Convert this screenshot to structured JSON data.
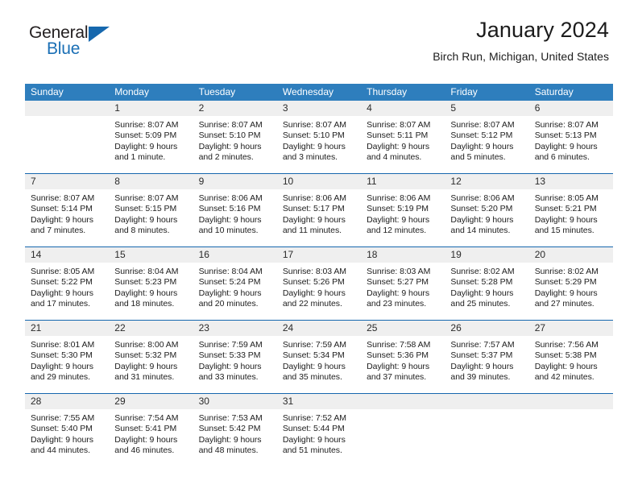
{
  "brand": {
    "name_top": "General",
    "name_bottom": "Blue",
    "triangle_color": "#1668ae",
    "blue_color": "#1a6fb5",
    "dark_color": "#231f20"
  },
  "header": {
    "title": "January 2024",
    "subtitle": "Birch Run, Michigan, United States"
  },
  "theme": {
    "header_blue": "#2e7ebd",
    "rule_blue": "#1667ae",
    "daynum_band": "#efefef",
    "text": "#202020"
  },
  "weekdays": [
    "Sunday",
    "Monday",
    "Tuesday",
    "Wednesday",
    "Thursday",
    "Friday",
    "Saturday"
  ],
  "weeks": [
    [
      {
        "day": "",
        "lines": [
          "",
          "",
          "",
          ""
        ]
      },
      {
        "day": "1",
        "lines": [
          "Sunrise: 8:07 AM",
          "Sunset: 5:09 PM",
          "Daylight: 9 hours",
          "and 1 minute."
        ]
      },
      {
        "day": "2",
        "lines": [
          "Sunrise: 8:07 AM",
          "Sunset: 5:10 PM",
          "Daylight: 9 hours",
          "and 2 minutes."
        ]
      },
      {
        "day": "3",
        "lines": [
          "Sunrise: 8:07 AM",
          "Sunset: 5:10 PM",
          "Daylight: 9 hours",
          "and 3 minutes."
        ]
      },
      {
        "day": "4",
        "lines": [
          "Sunrise: 8:07 AM",
          "Sunset: 5:11 PM",
          "Daylight: 9 hours",
          "and 4 minutes."
        ]
      },
      {
        "day": "5",
        "lines": [
          "Sunrise: 8:07 AM",
          "Sunset: 5:12 PM",
          "Daylight: 9 hours",
          "and 5 minutes."
        ]
      },
      {
        "day": "6",
        "lines": [
          "Sunrise: 8:07 AM",
          "Sunset: 5:13 PM",
          "Daylight: 9 hours",
          "and 6 minutes."
        ]
      }
    ],
    [
      {
        "day": "7",
        "lines": [
          "Sunrise: 8:07 AM",
          "Sunset: 5:14 PM",
          "Daylight: 9 hours",
          "and 7 minutes."
        ]
      },
      {
        "day": "8",
        "lines": [
          "Sunrise: 8:07 AM",
          "Sunset: 5:15 PM",
          "Daylight: 9 hours",
          "and 8 minutes."
        ]
      },
      {
        "day": "9",
        "lines": [
          "Sunrise: 8:06 AM",
          "Sunset: 5:16 PM",
          "Daylight: 9 hours",
          "and 10 minutes."
        ]
      },
      {
        "day": "10",
        "lines": [
          "Sunrise: 8:06 AM",
          "Sunset: 5:17 PM",
          "Daylight: 9 hours",
          "and 11 minutes."
        ]
      },
      {
        "day": "11",
        "lines": [
          "Sunrise: 8:06 AM",
          "Sunset: 5:19 PM",
          "Daylight: 9 hours",
          "and 12 minutes."
        ]
      },
      {
        "day": "12",
        "lines": [
          "Sunrise: 8:06 AM",
          "Sunset: 5:20 PM",
          "Daylight: 9 hours",
          "and 14 minutes."
        ]
      },
      {
        "day": "13",
        "lines": [
          "Sunrise: 8:05 AM",
          "Sunset: 5:21 PM",
          "Daylight: 9 hours",
          "and 15 minutes."
        ]
      }
    ],
    [
      {
        "day": "14",
        "lines": [
          "Sunrise: 8:05 AM",
          "Sunset: 5:22 PM",
          "Daylight: 9 hours",
          "and 17 minutes."
        ]
      },
      {
        "day": "15",
        "lines": [
          "Sunrise: 8:04 AM",
          "Sunset: 5:23 PM",
          "Daylight: 9 hours",
          "and 18 minutes."
        ]
      },
      {
        "day": "16",
        "lines": [
          "Sunrise: 8:04 AM",
          "Sunset: 5:24 PM",
          "Daylight: 9 hours",
          "and 20 minutes."
        ]
      },
      {
        "day": "17",
        "lines": [
          "Sunrise: 8:03 AM",
          "Sunset: 5:26 PM",
          "Daylight: 9 hours",
          "and 22 minutes."
        ]
      },
      {
        "day": "18",
        "lines": [
          "Sunrise: 8:03 AM",
          "Sunset: 5:27 PM",
          "Daylight: 9 hours",
          "and 23 minutes."
        ]
      },
      {
        "day": "19",
        "lines": [
          "Sunrise: 8:02 AM",
          "Sunset: 5:28 PM",
          "Daylight: 9 hours",
          "and 25 minutes."
        ]
      },
      {
        "day": "20",
        "lines": [
          "Sunrise: 8:02 AM",
          "Sunset: 5:29 PM",
          "Daylight: 9 hours",
          "and 27 minutes."
        ]
      }
    ],
    [
      {
        "day": "21",
        "lines": [
          "Sunrise: 8:01 AM",
          "Sunset: 5:30 PM",
          "Daylight: 9 hours",
          "and 29 minutes."
        ]
      },
      {
        "day": "22",
        "lines": [
          "Sunrise: 8:00 AM",
          "Sunset: 5:32 PM",
          "Daylight: 9 hours",
          "and 31 minutes."
        ]
      },
      {
        "day": "23",
        "lines": [
          "Sunrise: 7:59 AM",
          "Sunset: 5:33 PM",
          "Daylight: 9 hours",
          "and 33 minutes."
        ]
      },
      {
        "day": "24",
        "lines": [
          "Sunrise: 7:59 AM",
          "Sunset: 5:34 PM",
          "Daylight: 9 hours",
          "and 35 minutes."
        ]
      },
      {
        "day": "25",
        "lines": [
          "Sunrise: 7:58 AM",
          "Sunset: 5:36 PM",
          "Daylight: 9 hours",
          "and 37 minutes."
        ]
      },
      {
        "day": "26",
        "lines": [
          "Sunrise: 7:57 AM",
          "Sunset: 5:37 PM",
          "Daylight: 9 hours",
          "and 39 minutes."
        ]
      },
      {
        "day": "27",
        "lines": [
          "Sunrise: 7:56 AM",
          "Sunset: 5:38 PM",
          "Daylight: 9 hours",
          "and 42 minutes."
        ]
      }
    ],
    [
      {
        "day": "28",
        "lines": [
          "Sunrise: 7:55 AM",
          "Sunset: 5:40 PM",
          "Daylight: 9 hours",
          "and 44 minutes."
        ]
      },
      {
        "day": "29",
        "lines": [
          "Sunrise: 7:54 AM",
          "Sunset: 5:41 PM",
          "Daylight: 9 hours",
          "and 46 minutes."
        ]
      },
      {
        "day": "30",
        "lines": [
          "Sunrise: 7:53 AM",
          "Sunset: 5:42 PM",
          "Daylight: 9 hours",
          "and 48 minutes."
        ]
      },
      {
        "day": "31",
        "lines": [
          "Sunrise: 7:52 AM",
          "Sunset: 5:44 PM",
          "Daylight: 9 hours",
          "and 51 minutes."
        ]
      },
      {
        "day": "",
        "lines": [
          "",
          "",
          "",
          ""
        ]
      },
      {
        "day": "",
        "lines": [
          "",
          "",
          "",
          ""
        ]
      },
      {
        "day": "",
        "lines": [
          "",
          "",
          "",
          ""
        ]
      }
    ]
  ]
}
